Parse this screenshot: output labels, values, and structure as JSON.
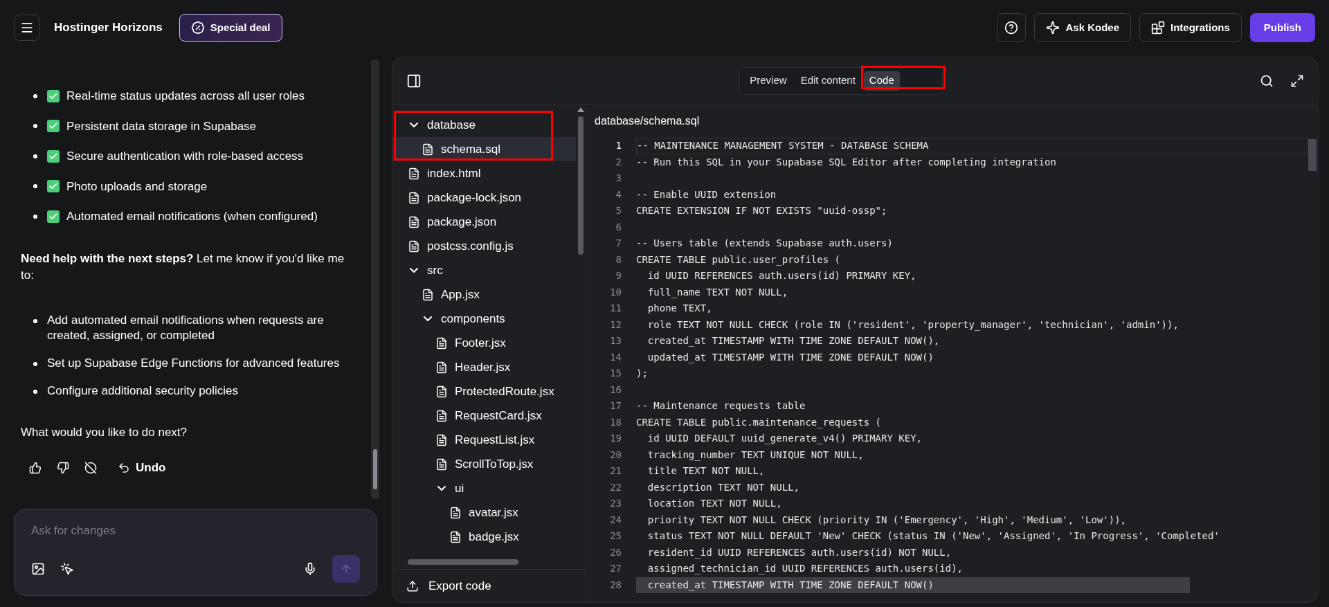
{
  "topbar": {
    "brand": "Hostinger Horizons",
    "deal_button": "Special deal",
    "ask_button": "Ask Kodee",
    "integrations_button": "Integrations",
    "publish_button": "Publish"
  },
  "chat": {
    "features": [
      {
        "text": "Real-time status updates across all user roles",
        "checked": true
      },
      {
        "text": "Persistent data storage in Supabase",
        "checked": true
      },
      {
        "text": "Secure authentication with role-based access",
        "checked": true
      },
      {
        "text": "Photo uploads and storage",
        "checked": true
      },
      {
        "text": "Automated email notifications (when configured)",
        "checked": true
      }
    ],
    "help_text": "**Need help with the next steps?** Let me know if you'd like me to:",
    "suggestions": [
      "Add automated email notifications when requests are created, assigned, or completed",
      "Set up Supabase Edge Functions for advanced features",
      "Configure additional security policies"
    ],
    "question": "What would you like to do next?",
    "undo_label": "Undo",
    "input_placeholder": "Ask for changes"
  },
  "editor": {
    "tabs": [
      {
        "label": "Preview",
        "selected": false
      },
      {
        "label": "Edit content",
        "selected": false
      },
      {
        "label": "Code",
        "selected": true
      }
    ],
    "tree": [
      {
        "name": "database",
        "kind": "folder",
        "expanded": true,
        "selected": false,
        "children": [
          {
            "name": "schema.sql",
            "kind": "file",
            "selected": true
          }
        ]
      },
      {
        "name": "index.html",
        "kind": "file",
        "selected": false
      },
      {
        "name": "package-lock.json",
        "kind": "file",
        "selected": false
      },
      {
        "name": "package.json",
        "kind": "file",
        "selected": false
      },
      {
        "name": "postcss.config.js",
        "kind": "file",
        "selected": false
      },
      {
        "name": "src",
        "kind": "folder",
        "expanded": true,
        "selected": false,
        "children": [
          {
            "name": "App.jsx",
            "kind": "file",
            "selected": false
          },
          {
            "name": "components",
            "kind": "folder",
            "expanded": true,
            "selected": false,
            "children": [
              {
                "name": "Footer.jsx",
                "kind": "file",
                "selected": false
              },
              {
                "name": "Header.jsx",
                "kind": "file",
                "selected": false
              },
              {
                "name": "ProtectedRoute.jsx",
                "kind": "file",
                "selected": false
              },
              {
                "name": "RequestCard.jsx",
                "kind": "file",
                "selected": false
              },
              {
                "name": "RequestList.jsx",
                "kind": "file",
                "selected": false
              },
              {
                "name": "ScrollToTop.jsx",
                "kind": "file",
                "selected": false
              },
              {
                "name": "ui",
                "kind": "folder",
                "expanded": true,
                "selected": false,
                "children": [
                  {
                    "name": "avatar.jsx",
                    "kind": "file",
                    "selected": false
                  },
                  {
                    "name": "badge.jsx",
                    "kind": "file",
                    "selected": false
                  }
                ]
              }
            ]
          }
        ]
      }
    ],
    "export_label": "Export code",
    "file_path": "database/schema.sql",
    "code_lines": [
      {
        "n": "1",
        "text": "-- MAINTENANCE MANAGEMENT SYSTEM - DATABASE SCHEMA",
        "active": true,
        "selected": false
      },
      {
        "n": "2",
        "text": "-- Run this SQL in your Supabase SQL Editor after completing integration",
        "active": false,
        "selected": false
      },
      {
        "n": "3",
        "active": false,
        "selected": false
      },
      {
        "n": "4",
        "text": "-- Enable UUID extension",
        "active": false,
        "selected": false
      },
      {
        "n": "5",
        "text": "CREATE EXTENSION IF NOT EXISTS \"uuid-ossp\";",
        "active": false,
        "selected": false
      },
      {
        "n": "6",
        "active": false,
        "selected": false
      },
      {
        "n": "7",
        "text": "-- Users table (extends Supabase auth.users)",
        "active": false,
        "selected": false
      },
      {
        "n": "8",
        "text": "CREATE TABLE public.user_profiles (",
        "active": false,
        "selected": false
      },
      {
        "n": "9",
        "text": "  id UUID REFERENCES auth.users(id) PRIMARY KEY,",
        "active": false,
        "selected": false
      },
      {
        "n": "10",
        "text": "  full_name TEXT NOT NULL,",
        "active": false,
        "selected": false
      },
      {
        "n": "11",
        "text": "  phone TEXT,",
        "active": false,
        "selected": false
      },
      {
        "n": "12",
        "text": "  role TEXT NOT NULL CHECK (role IN ('resident', 'property_manager', 'technician', 'admin')),",
        "active": false,
        "selected": false
      },
      {
        "n": "13",
        "text": "  created_at TIMESTAMP WITH TIME ZONE DEFAULT NOW(),",
        "active": false,
        "selected": false
      },
      {
        "n": "14",
        "text": "  updated_at TIMESTAMP WITH TIME ZONE DEFAULT NOW()",
        "active": false,
        "selected": false
      },
      {
        "n": "15",
        "text": ");",
        "active": false,
        "selected": false
      },
      {
        "n": "16",
        "active": false,
        "selected": false
      },
      {
        "n": "17",
        "text": "-- Maintenance requests table",
        "active": false,
        "selected": false
      },
      {
        "n": "18",
        "text": "CREATE TABLE public.maintenance_requests (",
        "active": false,
        "selected": false
      },
      {
        "n": "19",
        "text": "  id UUID DEFAULT uuid_generate_v4() PRIMARY KEY,",
        "active": false,
        "selected": false
      },
      {
        "n": "20",
        "text": "  tracking_number TEXT UNIQUE NOT NULL,",
        "active": false,
        "selected": false
      },
      {
        "n": "21",
        "text": "  title TEXT NOT NULL,",
        "active": false,
        "selected": false
      },
      {
        "n": "22",
        "text": "  description TEXT NOT NULL,",
        "active": false,
        "selected": false
      },
      {
        "n": "23",
        "text": "  location TEXT NOT NULL,",
        "active": false,
        "selected": false
      },
      {
        "n": "24",
        "text": "  priority TEXT NOT NULL CHECK (priority IN ('Emergency', 'High', 'Medium', 'Low')),",
        "active": false,
        "selected": false
      },
      {
        "n": "25",
        "text": "  status TEXT NOT NULL DEFAULT 'New' CHECK (status IN ('New', 'Assigned', 'In Progress', 'Completed'",
        "active": false,
        "selected": false
      },
      {
        "n": "26",
        "text": "  resident_id UUID REFERENCES auth.users(id) NOT NULL,",
        "active": false,
        "selected": false
      },
      {
        "n": "27",
        "text": "  assigned_technician_id UUID REFERENCES auth.users(id),",
        "active": false,
        "selected": false
      },
      {
        "n": "28",
        "text": "  created_at TIMESTAMP WITH TIME ZONE DEFAULT NOW()",
        "active": false,
        "selected": true
      }
    ]
  }
}
